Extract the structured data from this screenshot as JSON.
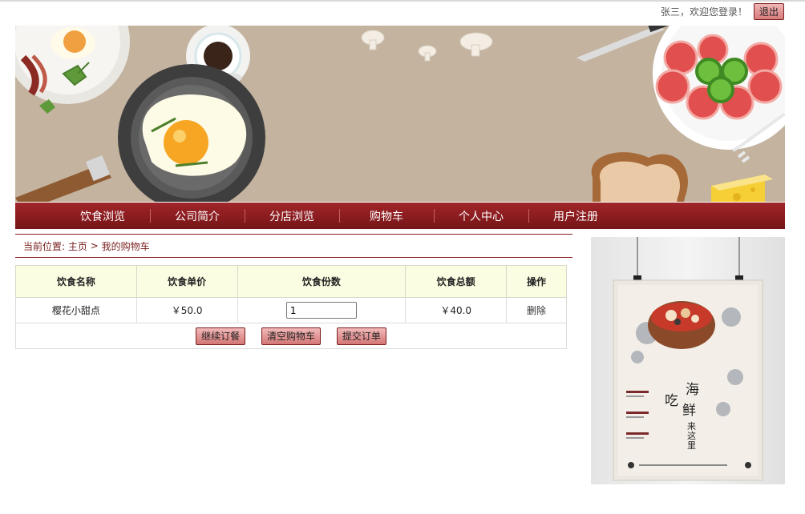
{
  "header": {
    "welcome": "张三，欢迎您登录！",
    "logout_label": "退出"
  },
  "nav": {
    "items": [
      "饮食浏览",
      "公司简介",
      "分店浏览",
      "购物车",
      "个人中心",
      "用户注册"
    ]
  },
  "breadcrumb": {
    "prefix": "当前位置: ",
    "home": "主页",
    "separator": " > ",
    "current": "我的购物车"
  },
  "cart": {
    "headers": [
      "饮食名称",
      "饮食单价",
      "饮食份数",
      "饮食总额",
      "操作"
    ],
    "rows": [
      {
        "name": "樱花小甜点",
        "price": "￥50.0",
        "quantity": "1",
        "total": "￥40.0",
        "action": "删除"
      }
    ],
    "buttons": {
      "continue": "继续订餐",
      "clear": "清空购物车",
      "submit": "提交订单"
    }
  },
  "poster": {
    "title_chars": [
      "海",
      "吃",
      "鲜",
      "来",
      "这",
      "里"
    ]
  },
  "colors": {
    "brand_red": "#8a1c1f",
    "header_bg": "#fbfde2",
    "banner_bg": "#c3b39f"
  }
}
